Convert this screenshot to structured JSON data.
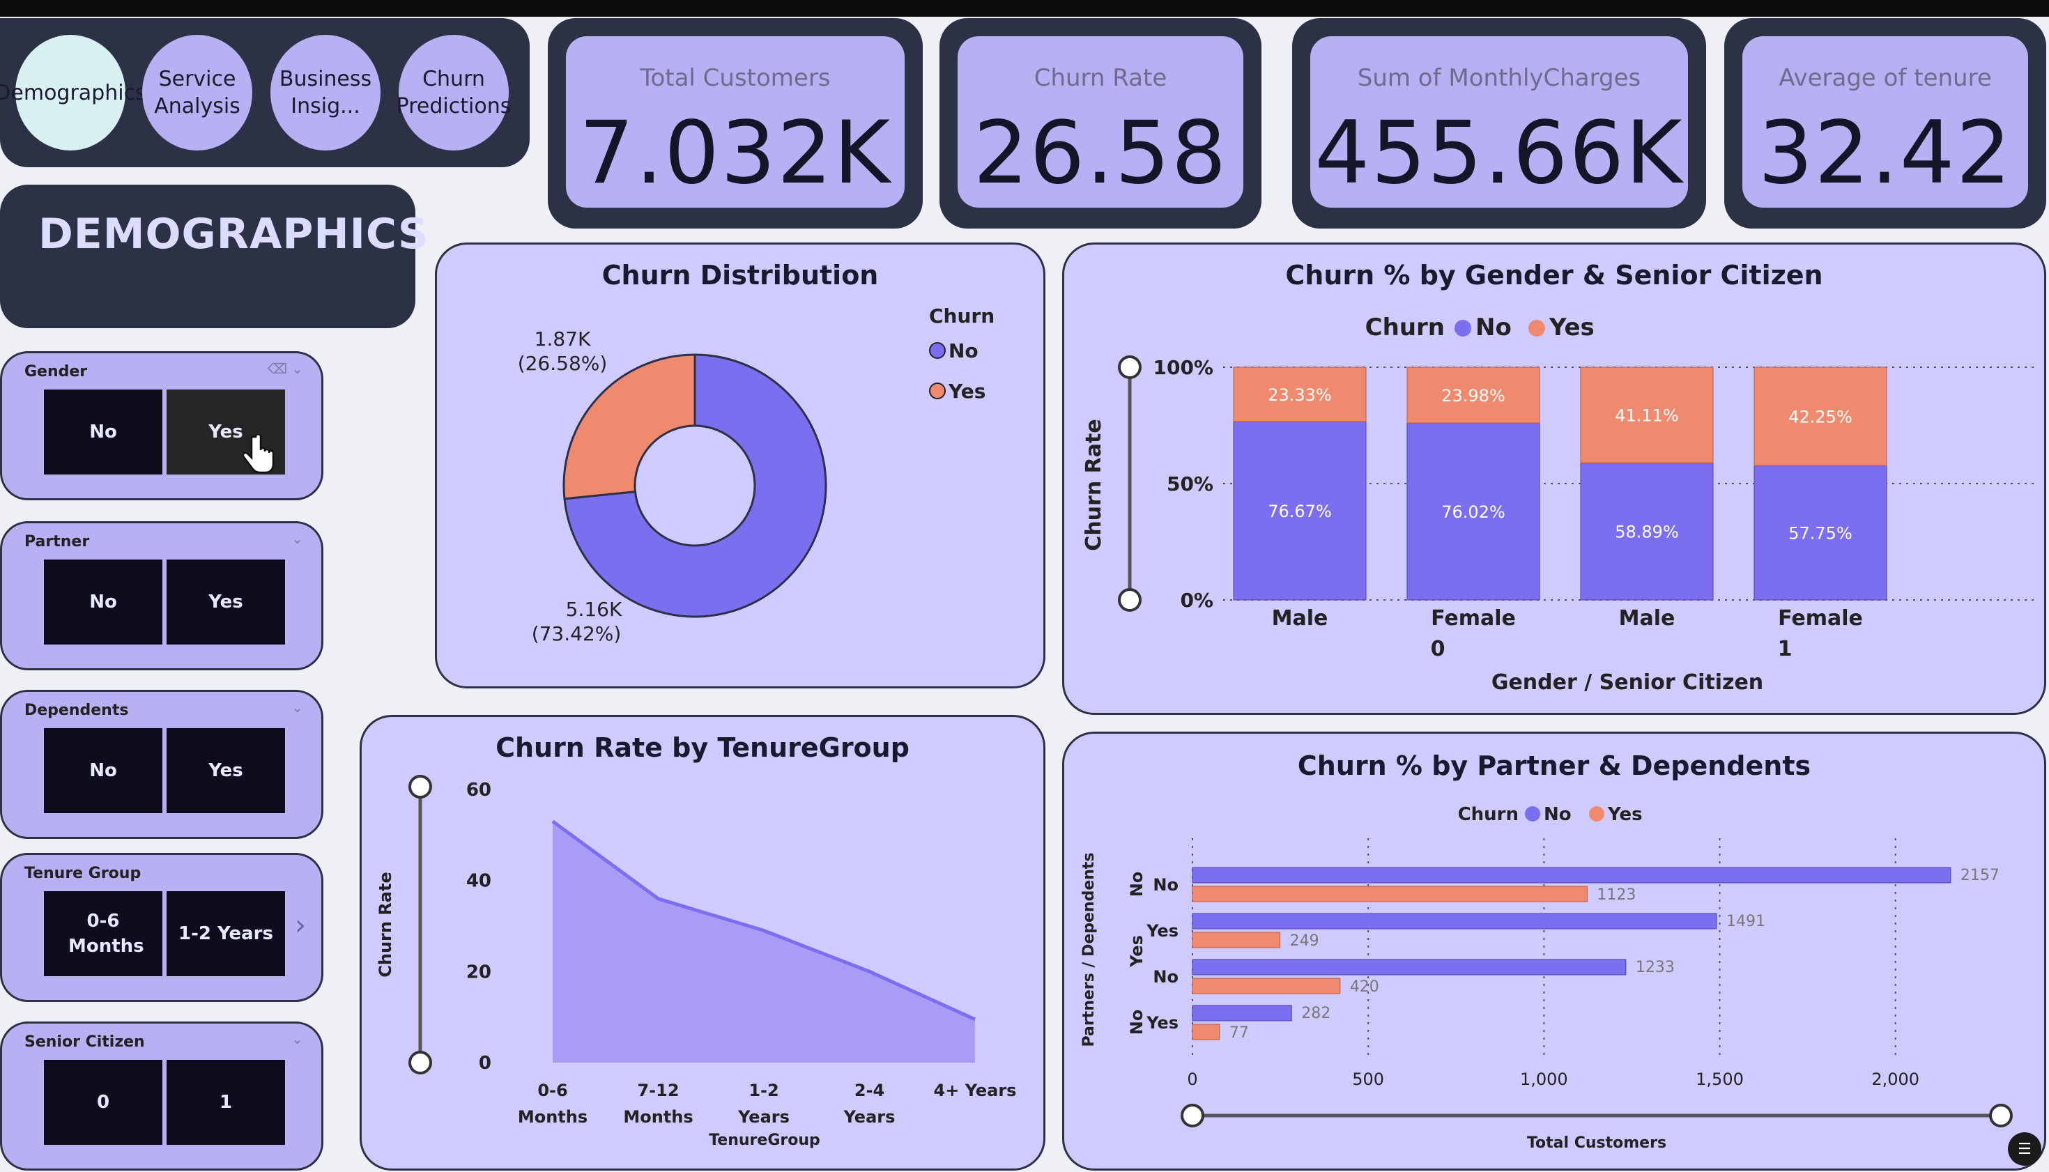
{
  "nav": {
    "demographics": "Demographics",
    "service": "Service Analysis",
    "business": "Business Insig...",
    "churn_pred": "Churn Predictions"
  },
  "page_title": "DEMOGRAPHICS",
  "kpis": [
    {
      "label": "Total Customers",
      "value": "7.032K"
    },
    {
      "label": "Churn Rate",
      "value": "26.58"
    },
    {
      "label": "Sum of MonthlyCharges",
      "value": "455.66K"
    },
    {
      "label": "Average of tenure",
      "value": "32.42"
    }
  ],
  "slicers": [
    {
      "title": "Gender",
      "options": [
        "No",
        "Yes"
      ],
      "selected": "Yes"
    },
    {
      "title": "Partner",
      "options": [
        "No",
        "Yes"
      ]
    },
    {
      "title": "Dependents",
      "options": [
        "No",
        "Yes"
      ]
    },
    {
      "title": "Tenure Group",
      "options": [
        "0-6 Months",
        "1-2 Years"
      ]
    },
    {
      "title": "Senior Citizen",
      "options": [
        "0",
        "1"
      ]
    }
  ],
  "colors": {
    "no": "#7b6ff0",
    "yes": "#f08a6e",
    "dark": "#2d3146",
    "card": "#cfcbff"
  },
  "chart_data": [
    {
      "type": "pie",
      "title": "Churn Distribution",
      "legend_title": "Churn",
      "categories": [
        "No",
        "Yes"
      ],
      "values": [
        5160,
        1870
      ],
      "labels": [
        "5.16K",
        "1.87K"
      ],
      "percent_labels": [
        "(73.42%)",
        "(26.58%)"
      ],
      "legend": "top-right"
    },
    {
      "type": "bar",
      "title": "Churn % by Gender & Senior Citizen",
      "legend_title": "Churn",
      "categories": [
        "Male",
        "Female",
        "Male",
        "Female"
      ],
      "groups": [
        "0",
        "1"
      ],
      "series": [
        {
          "name": "No",
          "values": [
            76.67,
            76.02,
            58.89,
            57.75
          ],
          "labels": [
            "76.67%",
            "76.02%",
            "58.89%",
            "57.75%"
          ]
        },
        {
          "name": "Yes",
          "values": [
            23.33,
            23.98,
            41.11,
            42.25
          ],
          "labels": [
            "23.33%",
            "23.98%",
            "41.11%",
            "42.25%"
          ]
        }
      ],
      "ylabel": "Churn Rate",
      "xlabel": "Gender / Senior Citizen",
      "ytick_labels": [
        "0%",
        "50%",
        "100%"
      ],
      "ylim": [
        0,
        100
      ],
      "grid": true
    },
    {
      "type": "area",
      "title": "Churn Rate by TenureGroup",
      "categories": [
        "0-6 Months",
        "7-12 Months",
        "1-2 Years",
        "2-4 Years",
        "4+ Years"
      ],
      "values": [
        53,
        36,
        29,
        20,
        9.5
      ],
      "ylabel": "Churn Rate",
      "xlabel": "TenureGroup",
      "ylim": [
        0,
        60
      ],
      "yticks": [
        0,
        20,
        40,
        60
      ]
    },
    {
      "type": "bar",
      "orientation": "horizontal",
      "title": "Churn % by Partner & Dependents",
      "legend_title": "Churn",
      "groups": [
        "No",
        "Yes",
        "No"
      ],
      "categories": [
        "No",
        "Yes",
        "No",
        "Yes"
      ],
      "series": [
        {
          "name": "No",
          "values": [
            2157,
            1491,
            1233,
            282
          ]
        },
        {
          "name": "Yes",
          "values": [
            1123,
            249,
            420,
            77
          ]
        }
      ],
      "ylabel": "Partners / Dependents",
      "xlabel": "Total Customers",
      "xlim": [
        0,
        2300
      ],
      "xticks": [
        0,
        500,
        1000,
        1500,
        2000
      ],
      "xtick_labels": [
        "0",
        "500",
        "1,000",
        "1,500",
        "2,000"
      ],
      "grid": true
    }
  ]
}
